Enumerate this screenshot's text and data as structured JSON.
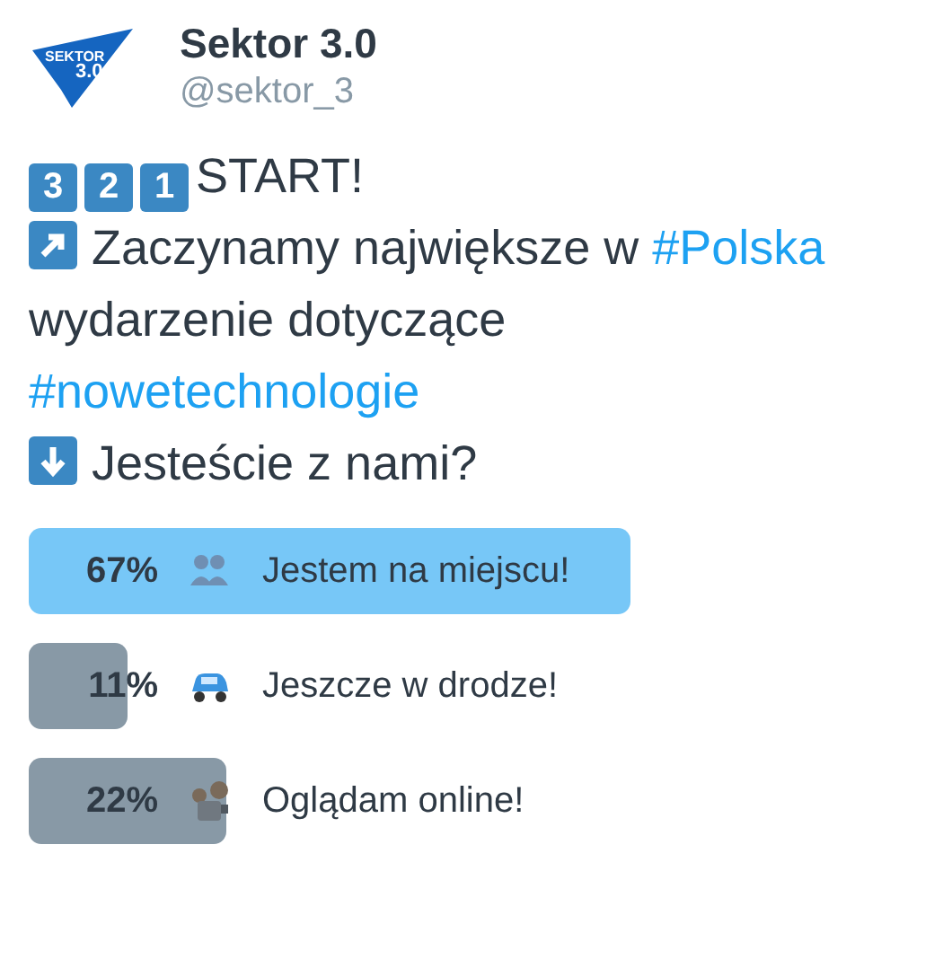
{
  "author": {
    "name": "Sektor 3.0",
    "handle": "@sektor_3",
    "avatar_text": [
      "SEKTOR",
      "3.0"
    ]
  },
  "tweet": {
    "lines": [
      {
        "kind": "keycaps",
        "keys": [
          "3",
          "2",
          "1"
        ],
        "segments": [
          {
            "text": "START!",
            "hashtag": false
          }
        ]
      },
      {
        "kind": "arrow-up-right",
        "segments": [
          {
            "text": "Zaczynamy największe w",
            "hashtag": false
          },
          {
            "text": "#Polska",
            "hashtag": true
          },
          {
            "text": "wydarzenie dotyczące",
            "hashtag": false
          },
          {
            "text": "#nowetechnologie",
            "hashtag": true
          }
        ]
      },
      {
        "kind": "arrow-down",
        "segments": [
          {
            "text": "Jesteście z nami?",
            "hashtag": false
          }
        ]
      }
    ]
  },
  "poll": {
    "options": [
      {
        "percent": "67%",
        "label": "Jestem na miejscu!",
        "kind": "people",
        "selected": true
      },
      {
        "percent": "11%",
        "label": "Jeszcze w drodze!",
        "kind": "car",
        "selected": false
      },
      {
        "percent": "22%",
        "label": "Oglądam online!",
        "kind": "projector",
        "selected": false
      }
    ]
  }
}
